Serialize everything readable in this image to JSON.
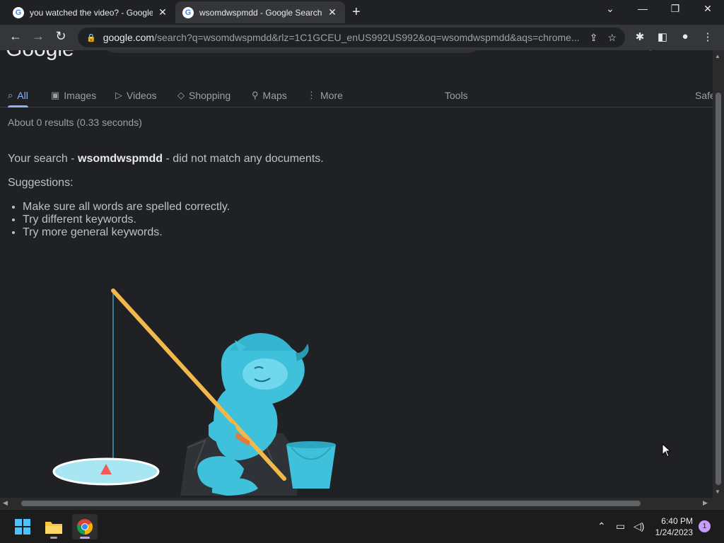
{
  "browser": {
    "tabs": [
      {
        "title": "you watched the video? - Google Search",
        "active": false
      },
      {
        "title": "wsomdwspmdd - Google Search",
        "active": true
      }
    ],
    "url_domain": "google.com",
    "url_rest": "/search?q=wsomdwspmdd&rlz=1C1GCEU_enUS992US992&oq=wsomdwspmdd&aqs=chrome...."
  },
  "page": {
    "logo": "Google",
    "query": "wsomdwspmdd",
    "nav_tabs": [
      {
        "label": "All",
        "icon": "search-icon"
      },
      {
        "label": "Images",
        "icon": "image-icon"
      },
      {
        "label": "Videos",
        "icon": "play-icon"
      },
      {
        "label": "Shopping",
        "icon": "tag-icon"
      },
      {
        "label": "Maps",
        "icon": "pin-icon"
      },
      {
        "label": "More",
        "icon": "more-vert-icon"
      }
    ],
    "tools_label": "Tools",
    "safe_label": "Safe",
    "stats": "About 0 results (0.33 seconds)",
    "nomatch_prefix": "Your search - ",
    "nomatch_query": "wsomdwspmdd",
    "nomatch_suffix": " - did not match any documents.",
    "suggestions_title": "Suggestions:",
    "suggestions": [
      "Make sure all words are spelled correctly.",
      "Try different keywords.",
      "Try more general keywords."
    ]
  },
  "taskbar": {
    "time": "6:40 PM",
    "date": "1/24/2023",
    "notification_count": "1"
  },
  "colors": {
    "background": "#202124",
    "accent": "#8ab4f8",
    "illustration_blue": "#3fc1dc"
  }
}
